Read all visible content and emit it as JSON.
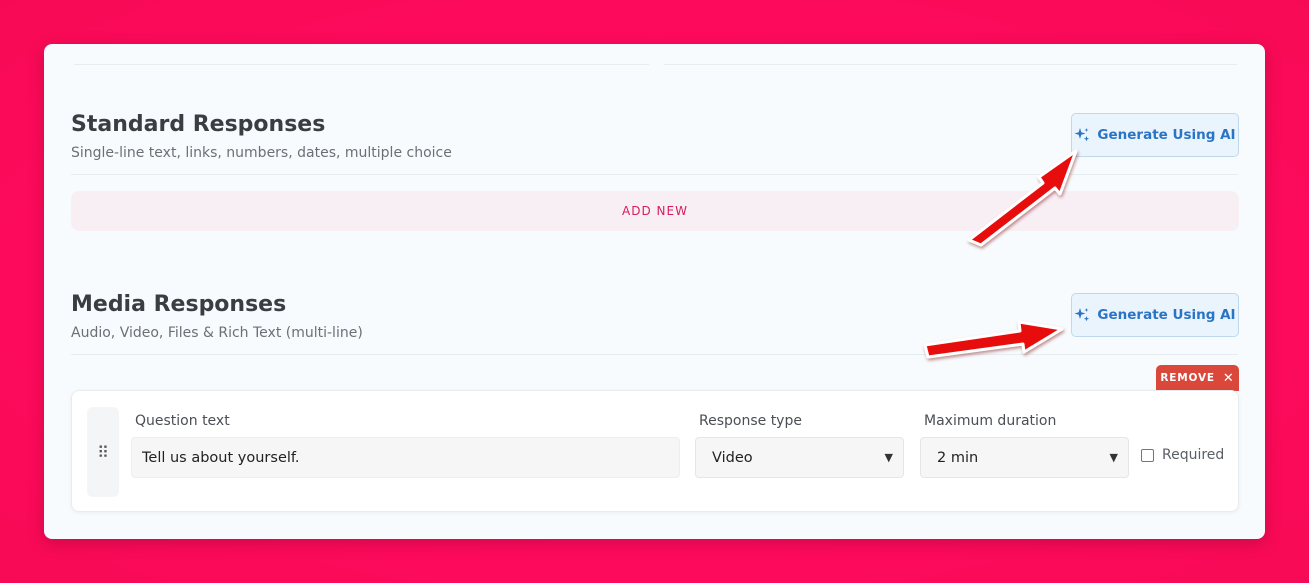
{
  "standard": {
    "title": "Standard Responses",
    "subtitle": "Single-line text, links, numbers, dates, multiple choice",
    "generate_label": "Generate Using AI",
    "add_new_label": "ADD NEW"
  },
  "media": {
    "title": "Media Responses",
    "subtitle": "Audio, Video, Files & Rich Text (multi-line)",
    "generate_label": "Generate Using AI"
  },
  "question": {
    "remove_label": "REMOVE",
    "remove_icon": "close-icon",
    "question_label": "Question text",
    "question_value": "Tell us about yourself.",
    "response_type_label": "Response type",
    "response_type_value": "Video",
    "duration_label": "Maximum duration",
    "duration_value": "2 min",
    "required_label": "Required"
  },
  "colors": {
    "background": "#ff0a5e",
    "accent_blue": "#2a74c6",
    "accent_pink": "#d81b60",
    "remove_red": "#d9483b",
    "arrow_red": "#e80c0c"
  }
}
